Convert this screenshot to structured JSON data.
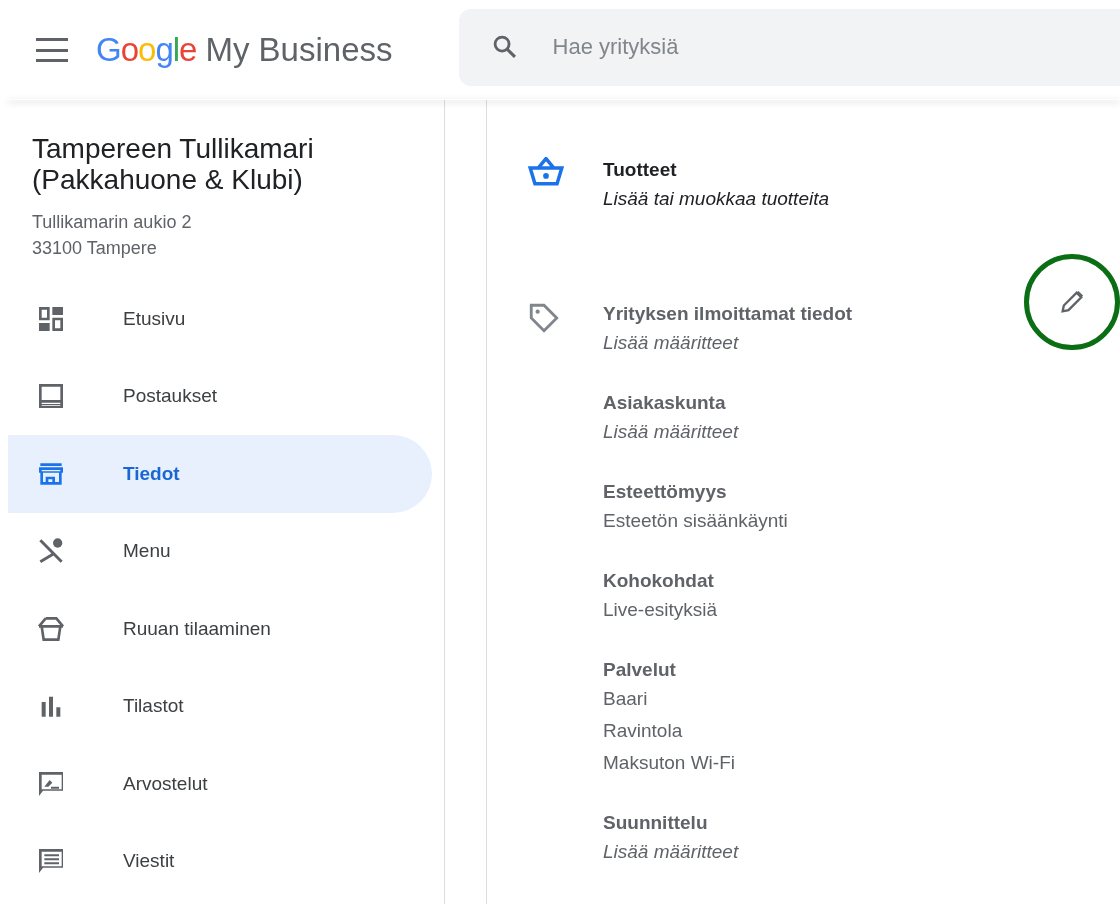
{
  "header": {
    "brand": {
      "logo": "Google",
      "product": "My Business"
    },
    "search": {
      "placeholder": "Hae yrityksiä"
    }
  },
  "sidebar": {
    "business_name": "Tampereen Tullikamari (Pakkahuone & Klubi)",
    "address": [
      "Tullikamarin aukio 2",
      "33100 Tampere"
    ],
    "items": [
      {
        "label": "Etusivu",
        "selected": false
      },
      {
        "label": "Postaukset",
        "selected": false
      },
      {
        "label": "Tiedot",
        "selected": true
      },
      {
        "label": "Menu",
        "selected": false
      },
      {
        "label": "Ruuan tilaaminen",
        "selected": false
      },
      {
        "label": "Tilastot",
        "selected": false
      },
      {
        "label": "Arvostelut",
        "selected": false
      },
      {
        "label": "Viestit",
        "selected": false
      }
    ]
  },
  "content": {
    "products": {
      "title": "Tuotteet",
      "subtitle": "Lisää tai muokkaa tuotteita"
    },
    "attributes": {
      "edit_button": {
        "highlighted": true
      },
      "groups": [
        {
          "title": "Yrityksen ilmoittamat tiedot",
          "values": [
            {
              "kind": "placeholder",
              "text": "Lisää määritteet"
            }
          ]
        },
        {
          "title": "Asiakaskunta",
          "values": [
            {
              "kind": "placeholder",
              "text": "Lisää määritteet"
            }
          ]
        },
        {
          "title": "Esteettömyys",
          "values": [
            {
              "kind": "value",
              "text": "Esteetön sisäänkäynti"
            }
          ]
        },
        {
          "title": "Kohokohdat",
          "values": [
            {
              "kind": "value",
              "text": "Live-esityksiä"
            }
          ]
        },
        {
          "title": "Palvelut",
          "values": [
            {
              "kind": "value",
              "text": "Baari"
            },
            {
              "kind": "value",
              "text": "Ravintola"
            },
            {
              "kind": "value",
              "text": "Maksuton Wi-Fi"
            }
          ]
        },
        {
          "title": "Suunnittelu",
          "values": [
            {
              "kind": "placeholder",
              "text": "Lisää määritteet"
            }
          ]
        }
      ]
    }
  }
}
